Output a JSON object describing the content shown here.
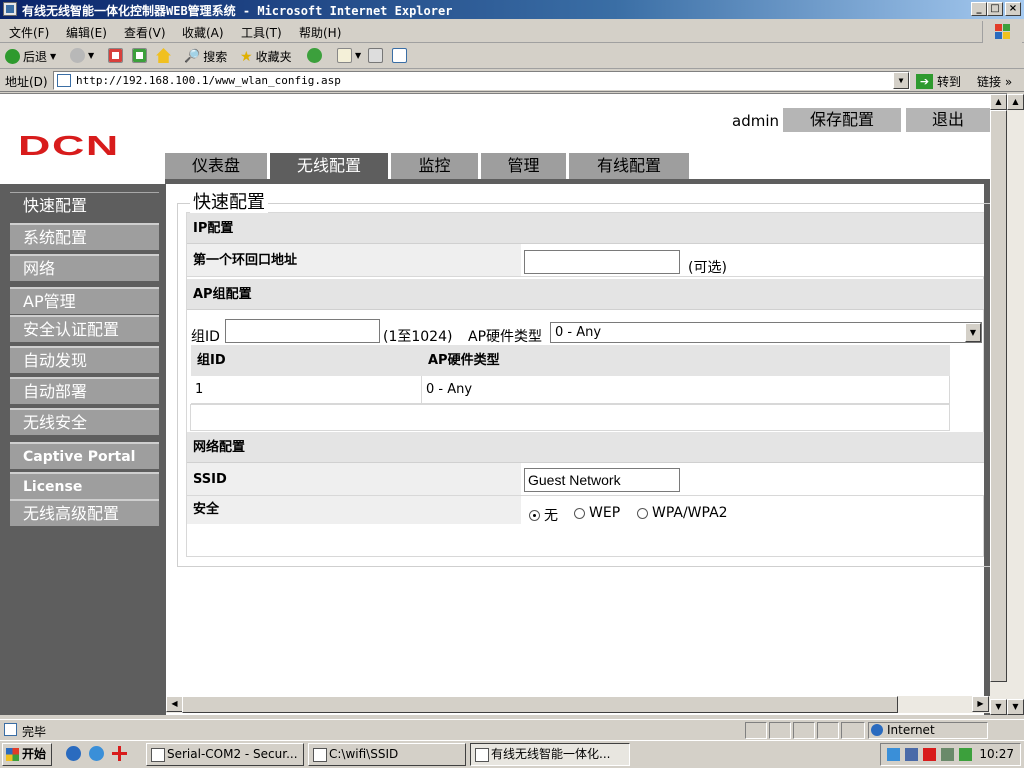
{
  "window": {
    "title": "有线无线智能一体化控制器WEB管理系统 - Microsoft Internet Explorer",
    "controls": {
      "minimize": "_",
      "maximize": "□",
      "close": "×"
    }
  },
  "menu": [
    "文件(F)",
    "编辑(E)",
    "查看(V)",
    "收藏(A)",
    "工具(T)",
    "帮助(H)"
  ],
  "toolbar": {
    "back": "后退",
    "search": "搜索",
    "favorites": "收藏夹"
  },
  "address": {
    "label": "地址(D)",
    "url": "http://192.168.100.1/www_wlan_config.asp",
    "go": "转到",
    "links": "链接"
  },
  "header": {
    "logo": "DCN",
    "user": "admin",
    "save_label": "保存配置",
    "logout_label": "退出"
  },
  "tabs": [
    {
      "label": "仪表盘"
    },
    {
      "label": "无线配置",
      "active": true
    },
    {
      "label": "监控"
    },
    {
      "label": "管理"
    },
    {
      "label": "有线配置"
    }
  ],
  "sidebar": {
    "items": [
      {
        "label": "快速配置",
        "active": true
      },
      {
        "label": "系统配置"
      },
      {
        "label": "网络"
      },
      {
        "label": "AP管理"
      },
      {
        "label": "安全认证配置"
      },
      {
        "label": "自动发现"
      },
      {
        "label": "自动部署"
      },
      {
        "label": "无线安全"
      },
      {
        "label": "Captive Portal"
      },
      {
        "label": "License"
      },
      {
        "label": "无线高级配置"
      }
    ]
  },
  "quick_config": {
    "title": "快速配置",
    "ip_section": {
      "heading": "IP配置",
      "loopback_label": "第一个环回口地址",
      "loopback_value": "",
      "optional_note": "(可选)"
    },
    "ap_group": {
      "heading": "AP组配置",
      "group_id_label": "组ID",
      "group_id_value": "",
      "range_note": "(1至1024)",
      "hw_type_label": "AP硬件类型",
      "hw_type_selected": "0 - Any",
      "table": {
        "columns": [
          "组ID",
          "AP硬件类型"
        ],
        "rows": [
          [
            "1",
            "0 - Any"
          ]
        ]
      }
    },
    "network": {
      "heading": "网络配置",
      "ssid_label": "SSID",
      "ssid_value": "Guest Network",
      "security_label": "安全",
      "security_options": [
        "无",
        "WEP",
        "WPA/WPA2"
      ],
      "security_selected": "无"
    }
  },
  "status": {
    "text": "完毕",
    "zone": "Internet"
  },
  "taskbar": {
    "start": "开始",
    "tasks": [
      "Serial-COM2 - Secur...",
      "C:\\wifi\\SSID",
      "有线无线智能一体化..."
    ],
    "clock": "10:27"
  },
  "colors": {
    "brand_red": "#d81c1c",
    "nav_gray": "#5e5e5e",
    "tab_gray": "#9e9e9e",
    "active_tab": "#5e5e5e"
  }
}
